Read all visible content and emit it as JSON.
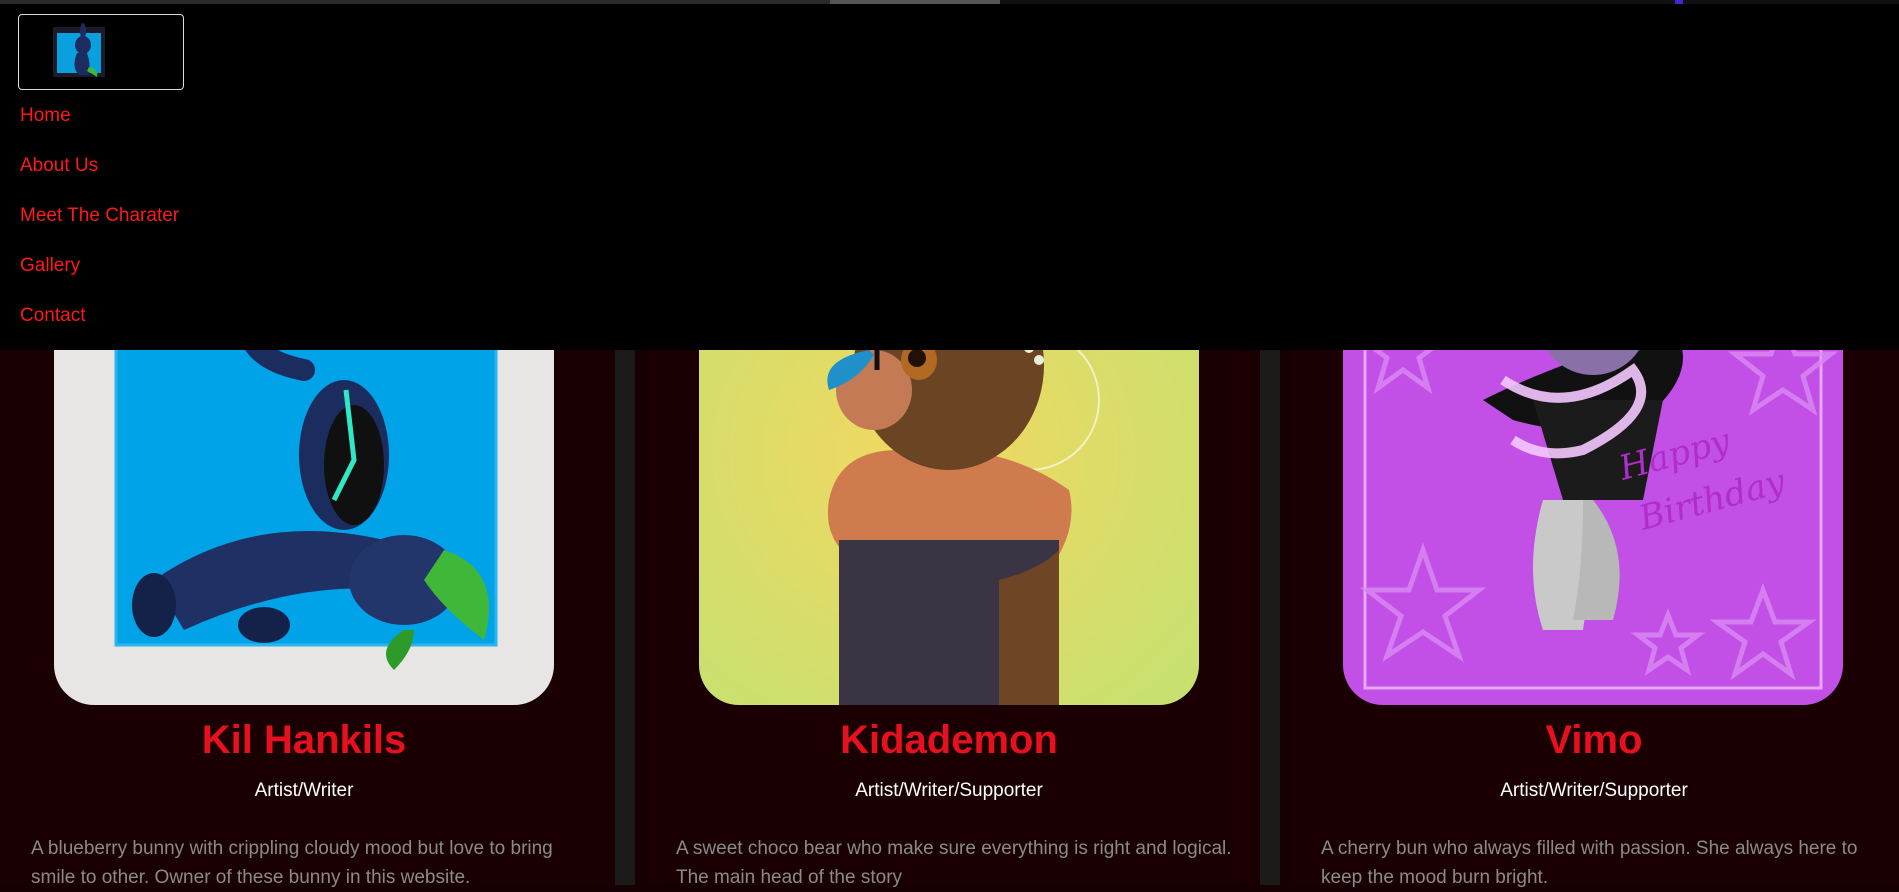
{
  "logo": {
    "icon": "blue-bunny-logo-icon"
  },
  "nav": {
    "items": [
      {
        "label": "Home"
      },
      {
        "label": "About Us"
      },
      {
        "label": "Meet The Charater"
      },
      {
        "label": "Gallery"
      },
      {
        "label": "Contact"
      }
    ]
  },
  "cards": [
    {
      "name": "Kil Hankils",
      "role": "Artist/Writer",
      "description": "A blueberry bunny with crippling cloudy mood but love to bring smile to other. Owner of these bunny in this website.",
      "accent": "#00a3e8"
    },
    {
      "name": "Kidademon",
      "role": "Artist/Writer/Supporter",
      "description": "A sweet choco bear who make sure everything is right and logical. The main head of the story",
      "accent": "#d8e06a"
    },
    {
      "name": "Vimo",
      "role": "Artist/Writer/Supporter",
      "description": "A cherry bun who always filled with passion. She always here to keep the mood burn bright.",
      "accent": "#c050e8",
      "art_text": "Happy Birthday"
    }
  ],
  "colors": {
    "background": "#160003",
    "header": "#000000",
    "nav_link": "#ff1a1a",
    "card_name": "#e6101f",
    "description": "#8a8a8a"
  }
}
